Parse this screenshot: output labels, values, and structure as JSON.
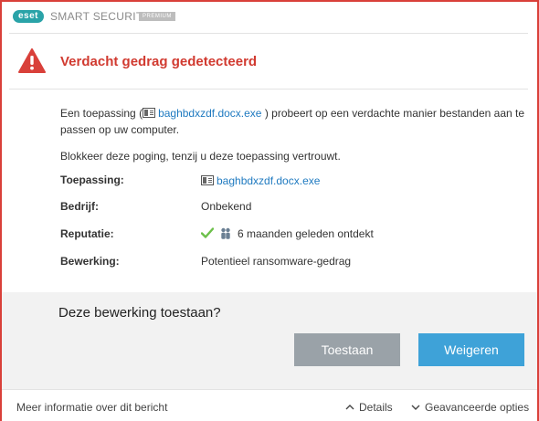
{
  "titlebar": {
    "logo": "eset",
    "product": "SMART SECURITY",
    "edition": "PREMIUM"
  },
  "alert": {
    "title": "Verdacht gedrag gedetecteerd",
    "icon": "warning-triangle-icon",
    "accent_color": "#d13a30"
  },
  "description": {
    "before": "Een toepassing (",
    "app": "baghbdxzdf.docx.exe",
    "after": " ) probeert op een verdachte manier bestanden aan te passen op uw computer."
  },
  "prompt": "Blokkeer deze poging, tenzij u deze toepassing vertrouwt.",
  "details": {
    "application": {
      "label": "Toepassing:",
      "value": "baghbdxzdf.docx.exe"
    },
    "company": {
      "label": "Bedrijf:",
      "value": "Onbekend"
    },
    "reputation": {
      "label": "Reputatie:",
      "value": "6 maanden geleden ontdekt"
    },
    "operation": {
      "label": "Bewerking:",
      "value": "Potentieel ransomware-gedrag"
    }
  },
  "action": {
    "question": "Deze bewerking toestaan?",
    "allow_label": "Toestaan",
    "deny_label": "Weigeren",
    "allow_color": "#9aa2a8",
    "deny_color": "#3ea2d8"
  },
  "footer": {
    "more_info": "Meer informatie over dit bericht",
    "details": "Details",
    "advanced": "Geavanceerde opties"
  }
}
